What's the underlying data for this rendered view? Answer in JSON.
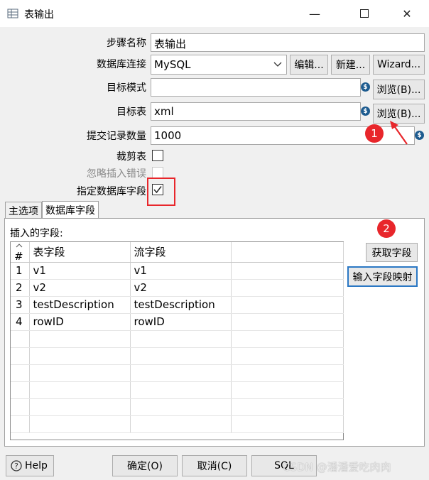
{
  "window": {
    "title": "表输出"
  },
  "form": {
    "step_name_label": "步骤名称",
    "step_name_value": "表输出",
    "db_conn_label": "数据库连接",
    "db_conn_value": "MySQL",
    "edit_btn": "编辑...",
    "new_btn": "新建...",
    "wizard_btn": "Wizard...",
    "target_schema_label": "目标模式",
    "target_schema_value": "",
    "browse_btn_1": "浏览(B)...",
    "target_table_label": "目标表",
    "target_table_value": "xml",
    "browse_btn_2": "浏览(B)...",
    "commit_size_label": "提交记录数量",
    "commit_size_value": "1000",
    "truncate_label": "裁剪表",
    "ignore_errors_label": "忽略插入错误",
    "specify_fields_label": "指定数据库字段"
  },
  "annotations": {
    "one": "1",
    "two": "2"
  },
  "tabs": [
    {
      "label": "主选项"
    },
    {
      "label": "数据库字段"
    }
  ],
  "fields_panel": {
    "title": "插入的字段:",
    "get_fields_btn": "获取字段",
    "map_fields_btn": "输入字段映射",
    "columns": [
      "#",
      "表字段",
      "流字段"
    ],
    "rows": [
      {
        "num": "1",
        "table_field": "v1",
        "stream_field": "v1"
      },
      {
        "num": "2",
        "table_field": "v2",
        "stream_field": "v2"
      },
      {
        "num": "3",
        "table_field": "testDescription",
        "stream_field": "testDescription"
      },
      {
        "num": "4",
        "table_field": "rowID",
        "stream_field": "rowID"
      }
    ]
  },
  "footer": {
    "help_btn": "Help",
    "ok_btn": "确定(O)",
    "cancel_btn": "取消(C)",
    "sql_btn": "SQL"
  },
  "watermark": "CSDN @潘潘爱吃肉肉"
}
